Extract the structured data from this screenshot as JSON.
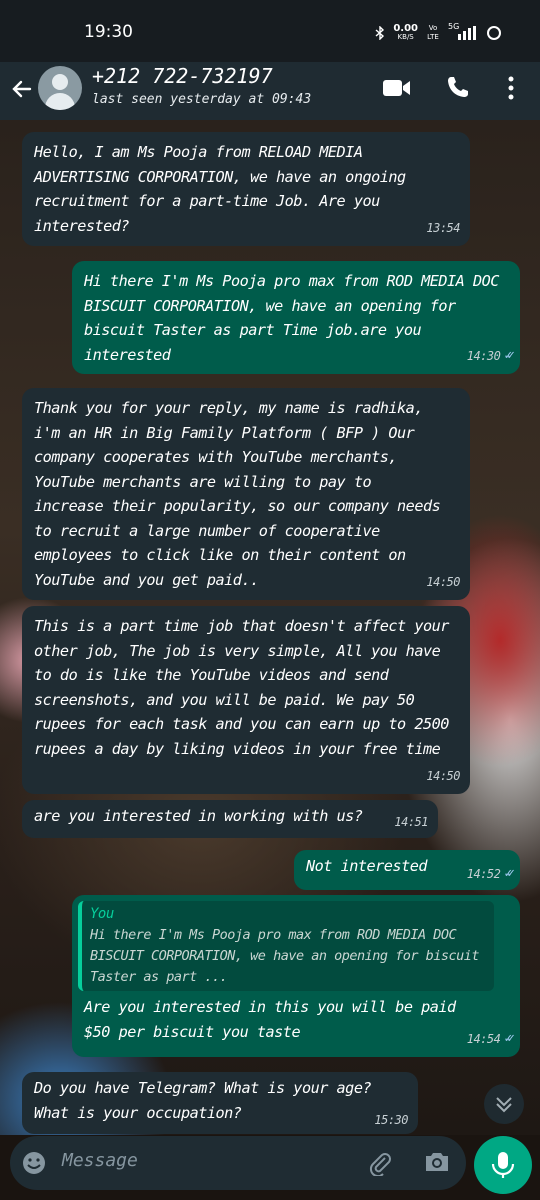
{
  "status_bar": {
    "time": "19:30",
    "data_rate": "0.00",
    "data_unit": "KB/S",
    "volte": "Vo LTE",
    "network": "5G"
  },
  "header": {
    "contact": "+212 722-732197",
    "last_seen": "last seen yesterday at 09:43"
  },
  "messages": [
    {
      "dir": "in",
      "text": "Hello, I am Ms Pooja from RELOAD MEDIA ADVERTISING CORPORATION, we have an ongoing recruitment for a part-time Job. Are you interested?",
      "time": "13:54"
    },
    {
      "dir": "out",
      "text": "Hi there I'm Ms Pooja pro max from ROD MEDIA DOC BISCUIT CORPORATION, we have an opening for biscuit Taster as part Time job.are you interested",
      "time": "14:30"
    },
    {
      "dir": "in",
      "text": "Thank you for your reply, my name is radhika, i'm an HR in Big Family Platform ( BFP ) Our company cooperates with YouTube merchants, YouTube merchants are willing to pay to increase their popularity, so our company needs to recruit a large number of cooperative employees to click like on their content on YouTube and you get paid..",
      "time": "14:50"
    },
    {
      "dir": "in",
      "text": "This is a part time job that doesn't affect your other job, The job is very simple, All you have to do is like the YouTube videos and send screenshots, and you will be paid. We pay 50 rupees for each task and you can earn up to 2500 rupees a day by liking videos in your free time",
      "time": "14:50"
    },
    {
      "dir": "in",
      "text": "are you interested in working with us?",
      "time": "14:51"
    },
    {
      "dir": "out",
      "text": "Not interested",
      "time": "14:52"
    },
    {
      "dir": "out",
      "quote_name": "You",
      "quote_text": "Hi there I'm Ms Pooja pro max from ROD MEDIA DOC BISCUIT CORPORATION, we have an opening for biscuit Taster as part  ...",
      "text": "Are you interested in this you will be paid $50 per biscuit you taste",
      "time": "14:54"
    },
    {
      "dir": "in",
      "text": "Do you have Telegram? What is your age? What is your occupation?",
      "time": "15:30"
    }
  ],
  "composer": {
    "placeholder": "Message"
  },
  "colors": {
    "incoming_bubble": "#1f2c33",
    "outgoing_bubble": "#005c4b",
    "accent": "#00a884",
    "read_ticks": "#9dc9ef"
  }
}
